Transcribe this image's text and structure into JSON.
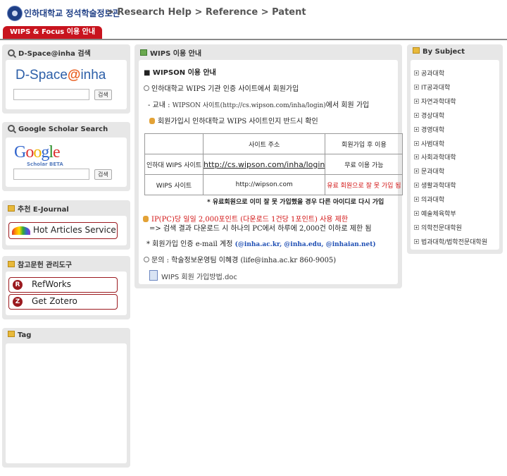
{
  "header": {
    "logo_text": "인하대학교 정석학술정보관",
    "breadcrumb": "> Research Help > Reference > Patent",
    "tab_label": "WIPS & Focus 이용 안내"
  },
  "left": {
    "dspace": {
      "title": "D-Space@inha 검색",
      "logo_main": "D-Space",
      "logo_at": "@",
      "logo_end": "inha",
      "button": "검색"
    },
    "google": {
      "title": "Google Scholar Search",
      "logo": "Google",
      "logo_sub": "Scholar BETA",
      "button": "검색"
    },
    "ejournal": {
      "title": "추천 E-Journal",
      "button": "Hot Articles Service"
    },
    "refmgr": {
      "title": "참고문헌 관리도구",
      "refworks": "RefWorks",
      "zotero": "Get Zotero"
    },
    "tag": {
      "title": "Tag"
    }
  },
  "main": {
    "title": "WIPS 이용 안내",
    "section_heading": "■ WIPSON 이용 안내",
    "intro": "인하대학교 WIPS 기관 인증 사이트에서 회원가입",
    "campus_prefix": "- 교내 :",
    "campus_site": "WIPSON 사이트(http://cs.wipson.com/inha/login)",
    "campus_suffix": "에서 회원 가입",
    "check_note": "회원가입시 인하대학교 WIPS 사이트인지 반드시 확인",
    "table": {
      "headers": [
        "",
        "사이트 주소",
        "회원가입 후 이용"
      ],
      "rows": [
        [
          "인하대 WIPS 사이트",
          "http://cs.wipson.com/inha/login",
          "무료 이용 가능"
        ],
        [
          "WIPS 사이트",
          "http://wipson.com",
          "유료 회원으로 잘 못 가입 됨"
        ]
      ]
    },
    "paid_note": "* 유료회원으로 이미 잘 못 가입했을 경우 다른 아이디로 다시 가입",
    "ip_limit": "IP(PC)당 일일 2,000포인트 (다운로드 1건당 1포인트) 사용 제한",
    "ip_detail": "=> 검색 결과 다운로드 시 하나의 PC에서 하루에 2,000건 이하로 제한 됨",
    "email_prefix": "* 회원가입 인증 e-mail 계정",
    "email_domains": "(@inha.ac.kr, @inha.edu, @inhaian.net)",
    "contact": "문의 : 학술정보운영팀 이혜경 (life@inha.ac.kr 860-9005)",
    "attachment": "WIPS 회원 가입방법.doc"
  },
  "subjects": {
    "title": "By Subject",
    "items": [
      "공과대학",
      "IT공과대학",
      "자연과학대학",
      "경상대학",
      "경영대학",
      "사범대학",
      "사회과학대학",
      "문과대학",
      "생활과학대학",
      "의과대학",
      "예술체육학부",
      "의학전문대학원",
      "법과대학/법학전문대학원"
    ]
  },
  "colors": {
    "tab_red": "#c8141e",
    "panel_gray": "#e7e7e7",
    "warn_red": "#d21414",
    "email_blue": "#1f4fb4"
  }
}
